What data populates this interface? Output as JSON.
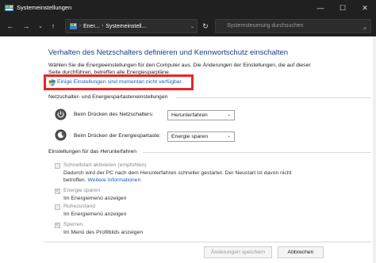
{
  "window": {
    "title": "Systemeinstellungen",
    "minimize": "—",
    "maximize": "☐",
    "close": "✕"
  },
  "nav": {
    "back": "←",
    "forward": "→",
    "recent": "⌄",
    "up": "↑",
    "breadcrumb": [
      "Ener...",
      "Systemeinstell..."
    ],
    "breadcrumb_sep": "›",
    "dropdown": "⌄",
    "refresh": "↻",
    "search_placeholder": "Systemsteuerung durchsuchen",
    "search_icon": "⌕"
  },
  "main": {
    "heading": "Verhalten des Netzschalters definieren und Kennwortschutz einschalten",
    "description": "Wählen Sie die Energieeinstellungen für den Computer aus. Die Änderungen der Einstellungen, die auf dieser Seite durchführen, betreffen alle Energiesparpläne.",
    "unavailable_link": "Einige Einstellungen sind momentan nicht verfügbar.",
    "buttons_section_title": "Netzschalter- und Energiespartasteneinstellungen",
    "power_button": {
      "label": "Beim Drücken des Netzschalters:",
      "value": "Herunterfahren"
    },
    "sleep_button": {
      "label": "Beim Drücken der Energiespartaste:",
      "value": "Energie sparen"
    },
    "shutdown_section_title": "Einstellungen für das Herunterfahren",
    "options": [
      {
        "title": "Schnellstart aktivieren (empfohlen)",
        "desc_line1": "Dadurch wird der PC nach dem Herunterfahren schneller gestartet. Der Neustart ist davon nicht",
        "desc_line2": "betroffen.",
        "link": "Weitere Informationen",
        "checked": false
      },
      {
        "title": "Energie sparen",
        "desc": "Im Energiemenü anzeigen",
        "checked": true
      },
      {
        "title": "Ruhezustand",
        "desc": "Im Energiemenü anzeigen",
        "checked": false
      },
      {
        "title": "Sperren",
        "desc": "Im Menü des Profilbilds anzeigen",
        "checked": true
      }
    ],
    "caret": "⌄"
  },
  "footer": {
    "save": "Änderungen speichern",
    "cancel": "Abbrechen"
  },
  "colors": {
    "titlebar": "#202020",
    "heading": "#1e3a8a",
    "link": "#1a5fb4",
    "highlight": "#e3262b"
  }
}
